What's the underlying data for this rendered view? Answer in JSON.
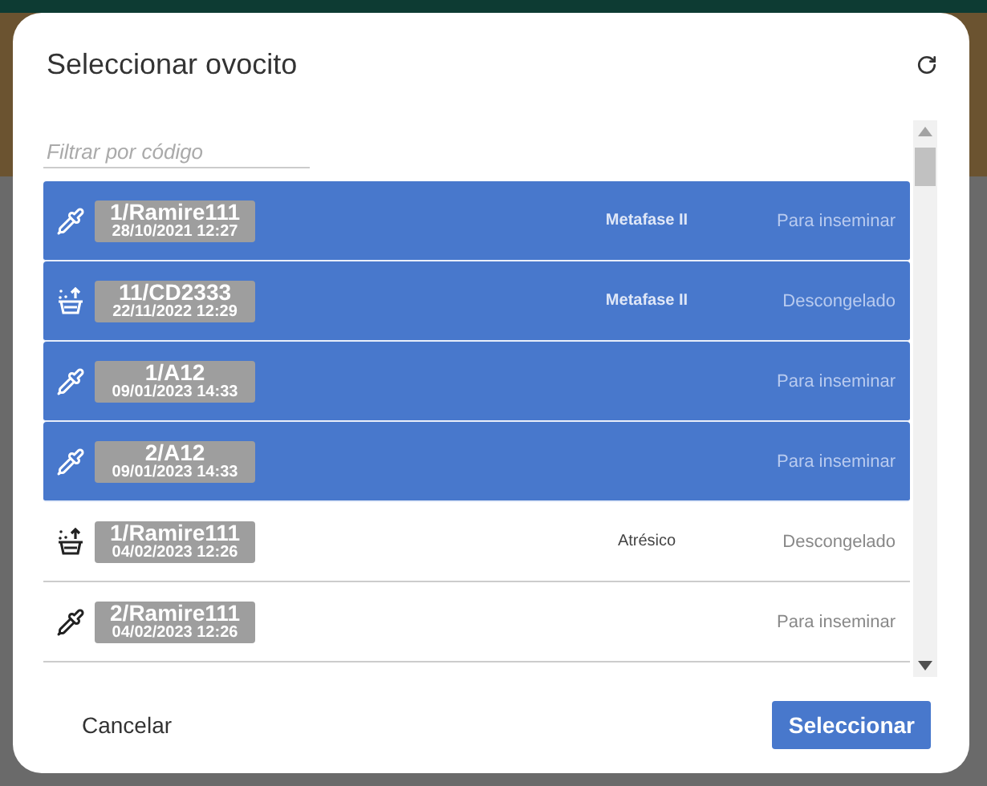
{
  "dialog": {
    "title": "Seleccionar ovocito"
  },
  "filter": {
    "placeholder": "Filtrar por código"
  },
  "oocytes": [
    {
      "kind": "pipette",
      "code": "1/Ramire111",
      "date": "28/10/2021 12:27",
      "stage": "Metafase II",
      "status": "Para inseminar",
      "selected": true
    },
    {
      "kind": "thawed",
      "code": "11/CD2333",
      "date": "22/11/2022 12:29",
      "stage": "Metafase II",
      "status": "Descongelado",
      "selected": true
    },
    {
      "kind": "pipette",
      "code": "1/A12",
      "date": "09/01/2023 14:33",
      "status": "Para inseminar",
      "selected": true
    },
    {
      "kind": "pipette",
      "code": "2/A12",
      "date": "09/01/2023 14:33",
      "status": "Para inseminar",
      "selected": true
    },
    {
      "kind": "thawed",
      "code": "1/Ramire111",
      "date": "04/02/2023 12:26",
      "stage": "Atrésico",
      "status": "Descongelado",
      "selected": false
    },
    {
      "kind": "pipette",
      "code": "2/Ramire111",
      "date": "04/02/2023 12:26",
      "status": "Para inseminar",
      "selected": false
    }
  ],
  "buttons": {
    "cancel": "Cancelar",
    "confirm": "Seleccionar"
  }
}
